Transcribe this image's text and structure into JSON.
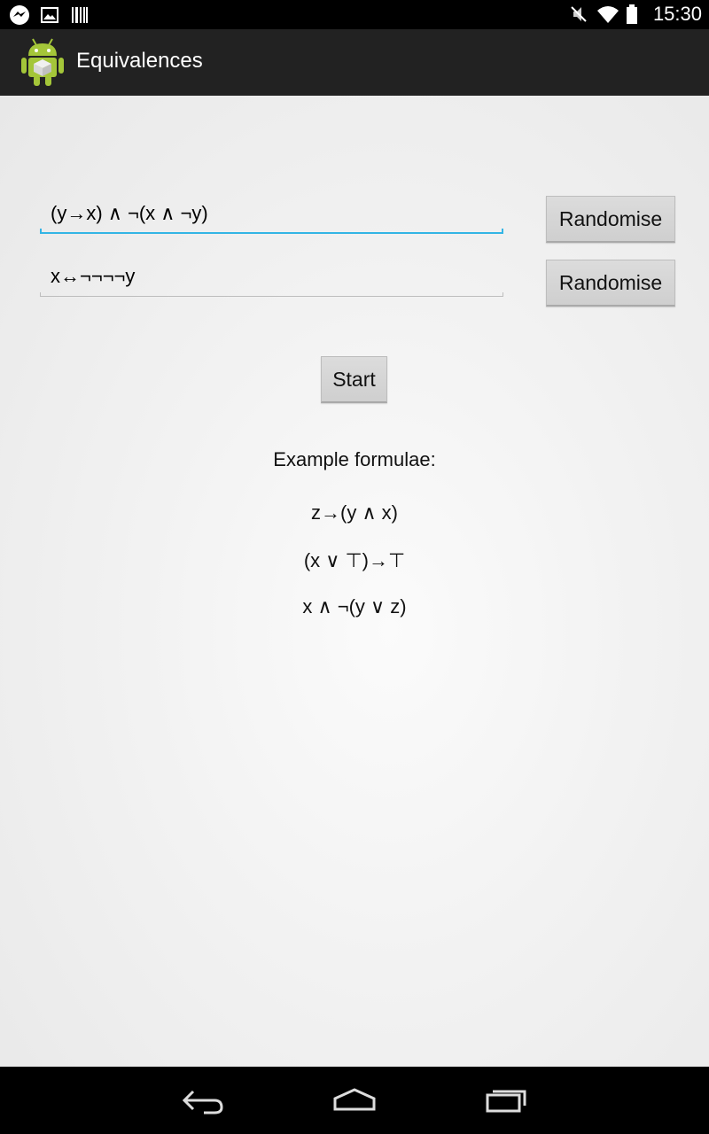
{
  "status": {
    "time": "15:30"
  },
  "app": {
    "title": "Equivalences"
  },
  "formula1": {
    "value": "(y→x) ∧ ¬(x ∧ ¬y)"
  },
  "formula2": {
    "value": "x↔¬¬¬¬y"
  },
  "buttons": {
    "randomise1": "Randomise",
    "randomise2": "Randomise",
    "start": "Start"
  },
  "examples": {
    "heading": "Example formulae:",
    "items": [
      "z→(y ∧ x)",
      "(x ∨ ⊤)→⊤",
      "x ∧ ¬(y ∨ z)"
    ]
  },
  "colors": {
    "accent": "#33b5e5",
    "actionbar": "#222222",
    "android_green": "#a4c639"
  },
  "icons": [
    "messenger-icon",
    "image-icon",
    "barcode-icon",
    "mute-icon",
    "wifi-icon",
    "battery-icon",
    "back-icon",
    "home-icon",
    "recents-icon"
  ]
}
